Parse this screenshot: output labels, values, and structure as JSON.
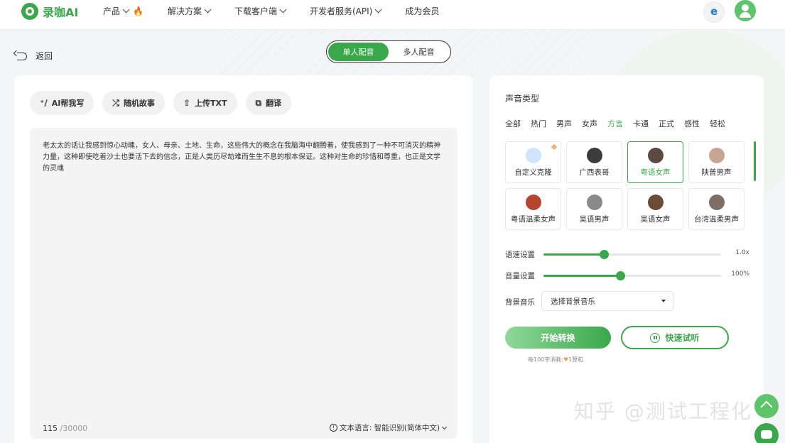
{
  "header": {
    "logo_text": "录咖AI",
    "nav": [
      {
        "label": "产品",
        "chevron": true,
        "badge_icon": "fire-icon"
      },
      {
        "label": "解决方案",
        "chevron": true
      },
      {
        "label": "下载客户端",
        "chevron": true
      },
      {
        "label": "开发者服务(API)",
        "chevron": true
      },
      {
        "label": "成为会员",
        "chevron": false
      }
    ]
  },
  "back_label": "返回",
  "mode": {
    "options": [
      "单人配音",
      "多人配音"
    ],
    "selected": "单人配音"
  },
  "tools": [
    {
      "label": "AI帮我写",
      "icon": "sparkle-pen-icon"
    },
    {
      "label": "随机故事",
      "icon": "shuffle-icon"
    },
    {
      "label": "上传TXT",
      "icon": "upload-icon"
    },
    {
      "label": "翻译",
      "icon": "translate-icon"
    }
  ],
  "editor": {
    "text": "老太太的话让我感到惊心动魄，女人、母亲、土地、生命，这些伟大的概念在我脑海中翻腾着，使我感到了一种不可消灭的精神力量，这种即使吃着沙土也要活下去的信念，正是人类历尽劫难而生生不息的根本保证。这种对生命的珍惜和尊重，也正是文学的灵魂",
    "char_count": "115",
    "char_max": "/30000",
    "language_label": "文本语言: 智能识别(简体中文)"
  },
  "voice_panel": {
    "title": "声音类型",
    "categories": [
      "全部",
      "热门",
      "男声",
      "女声",
      "方言",
      "卡通",
      "正式",
      "感性",
      "轻松"
    ],
    "active_category": "方言",
    "voices": [
      {
        "name": "自定义克隆",
        "color": "#cfe4ff",
        "selected": false
      },
      {
        "name": "广西表哥",
        "color": "#3b3b3b",
        "selected": false
      },
      {
        "name": "粤语女声",
        "color": "#5b4a42",
        "selected": true
      },
      {
        "name": "陕普男声",
        "color": "#c9a493",
        "selected": false
      },
      {
        "name": "粤语温柔女声",
        "color": "#b5452f",
        "selected": false
      },
      {
        "name": "吴语男声",
        "color": "#8a8a8a",
        "selected": false
      },
      {
        "name": "吴语女声",
        "color": "#6b4a36",
        "selected": false
      },
      {
        "name": "台湾温柔男声",
        "color": "#7d6e66",
        "selected": false
      }
    ],
    "speed_label": "语速设置",
    "speed_value": "1.0x",
    "speed_fraction": 0.34,
    "volume_label": "音量设置",
    "volume_value": "100%",
    "volume_fraction": 0.43,
    "bgm_label": "背景音乐",
    "bgm_placeholder": "选择背景音乐",
    "start_label": "开始转换",
    "listen_label": "快速试听",
    "cost_prefix": "每100字消耗:",
    "cost_suffix": "1算粒"
  },
  "watermark": "知乎 @测试工程化",
  "colors": {
    "accent": "#3aa84a"
  }
}
